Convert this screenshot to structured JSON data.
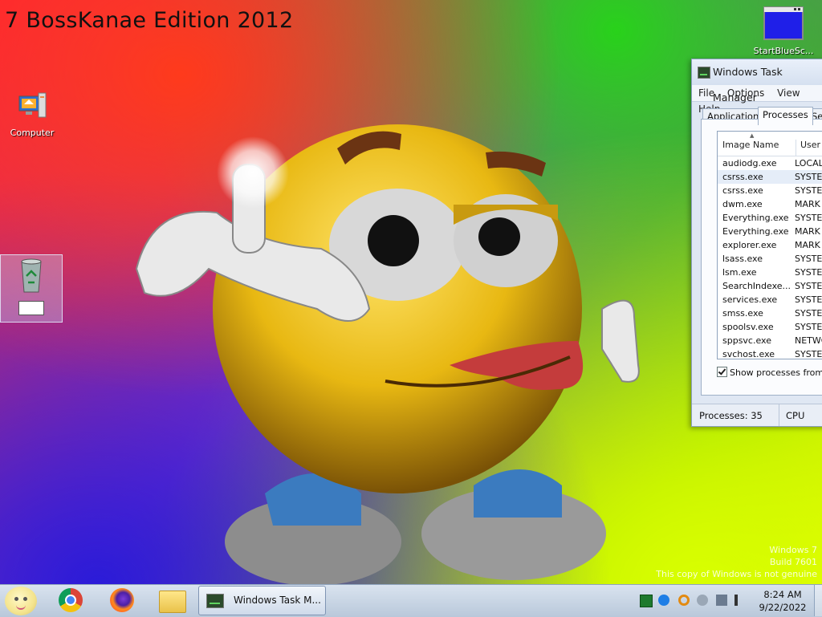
{
  "desktop": {
    "edition_text": "7 BossKanae Edition 2012",
    "icons": {
      "computer": "Computer",
      "recycle_bin": "",
      "bluescreen": "StartBlueSc..."
    },
    "watermark": {
      "line1": "Windows 7",
      "line2": "Build 7601",
      "line3": "This copy of Windows is not genuine"
    }
  },
  "task_manager": {
    "title": "Windows Task Manager",
    "menu": [
      "File",
      "Options",
      "View",
      "Help"
    ],
    "tabs": [
      "Applications",
      "Processes",
      "Services"
    ],
    "active_tab": "Processes",
    "columns": [
      "Image Name",
      "User Na"
    ],
    "processes": [
      {
        "name": "audiodg.exe",
        "user": "LOCAL"
      },
      {
        "name": "csrss.exe",
        "user": "SYSTEM"
      },
      {
        "name": "csrss.exe",
        "user": "SYSTEM"
      },
      {
        "name": "dwm.exe",
        "user": "MARK Z"
      },
      {
        "name": "Everything.exe",
        "user": "SYSTEM"
      },
      {
        "name": "Everything.exe",
        "user": "MARK Z"
      },
      {
        "name": "explorer.exe",
        "user": "MARK Z"
      },
      {
        "name": "lsass.exe",
        "user": "SYSTEM"
      },
      {
        "name": "lsm.exe",
        "user": "SYSTEM"
      },
      {
        "name": "SearchIndexe...",
        "user": "SYSTEM"
      },
      {
        "name": "services.exe",
        "user": "SYSTEM"
      },
      {
        "name": "smss.exe",
        "user": "SYSTEM"
      },
      {
        "name": "spoolsv.exe",
        "user": "SYSTEM"
      },
      {
        "name": "sppsvc.exe",
        "user": "NETWO"
      },
      {
        "name": "svchost.exe",
        "user": "SYSTEM"
      }
    ],
    "selected_index": 1,
    "show_all_label": "Show processes from all",
    "status_processes": "Processes: 35",
    "status_cpu": "CPU Usag"
  },
  "taskbar": {
    "task_button": "Windows Task M...",
    "clock_time": "8:24 AM",
    "clock_date": "9/22/2022"
  },
  "colors": {
    "taskbar": "#c9d6e5",
    "window_frame": "#dfe7f3"
  }
}
